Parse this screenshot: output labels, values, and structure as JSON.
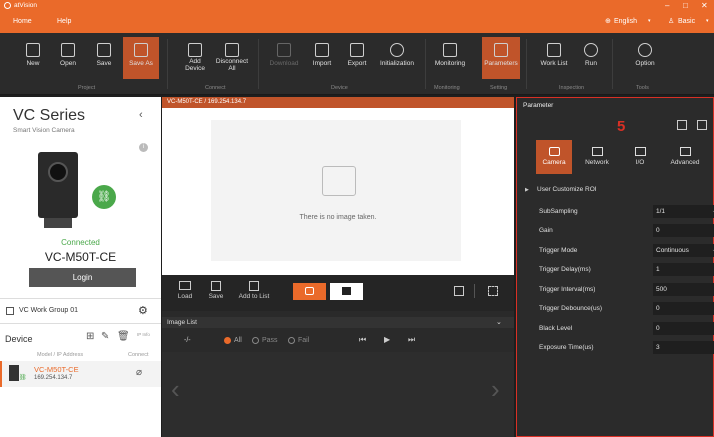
{
  "app": {
    "title": "atVision",
    "win_controls": [
      "–",
      "□",
      "✕"
    ]
  },
  "menu": {
    "home": "Home",
    "help": "Help",
    "language": "English",
    "mode": "Basic"
  },
  "ribbon": {
    "buttons": [
      {
        "label": "New",
        "icon": "new-file-icon"
      },
      {
        "label": "Open",
        "icon": "folder-open-icon"
      },
      {
        "label": "Save",
        "icon": "save-icon"
      },
      {
        "label": "Save As",
        "icon": "save-as-icon"
      },
      {
        "label": "Add Device",
        "icon": "add-device-icon"
      },
      {
        "label": "Disconnect All",
        "icon": "disconnect-icon"
      },
      {
        "label": "Download",
        "icon": "download-icon"
      },
      {
        "label": "Import",
        "icon": "import-icon"
      },
      {
        "label": "Export",
        "icon": "export-icon"
      },
      {
        "label": "Initialization",
        "icon": "reset-icon"
      },
      {
        "label": "Monitoring",
        "icon": "monitor-icon"
      },
      {
        "label": "Parameters",
        "icon": "sliders-icon"
      },
      {
        "label": "Work List",
        "icon": "clipboard-icon"
      },
      {
        "label": "Run",
        "icon": "play-icon"
      },
      {
        "label": "Option",
        "icon": "gear-icon"
      }
    ],
    "groups": [
      "Project",
      "Connect",
      "Device",
      "Monitoring",
      "Setting",
      "Inspection",
      "Tools"
    ]
  },
  "left": {
    "series": "VC Series",
    "subtitle": "Smart Vision Camera",
    "status": "Connected",
    "model": "VC-M50T-CE",
    "login": "Login",
    "workgroup": "VC Work Group 01",
    "device_header": "Device",
    "ip_header": "IP Info",
    "col_model": "Model / IP Address",
    "col_connect": "Connect",
    "devices": [
      {
        "model": "VC-M50T-CE",
        "ip": "169.254.134.7"
      }
    ]
  },
  "center": {
    "tab": "VC-M50T-CE / 169.254.134.7",
    "no_image": "There is no image taken.",
    "toolbar": [
      "Load",
      "Save",
      "Add to List"
    ],
    "image_list": "Image List",
    "counter": "-/-",
    "filters": [
      "All",
      "Pass",
      "Fail"
    ]
  },
  "right": {
    "header": "Parameter",
    "annotation": "5",
    "tabs": [
      "Camera",
      "Network",
      "I/O",
      "Advanced"
    ],
    "roi": "User Customize ROI",
    "params": [
      {
        "label": "SubSampling",
        "value": "1/1",
        "dropdown": true
      },
      {
        "label": "Gain",
        "value": "0",
        "dropdown": false
      },
      {
        "label": "Trigger Mode",
        "value": "Continuous",
        "dropdown": true
      },
      {
        "label": "Trigger Delay(ms)",
        "value": "1",
        "dropdown": false
      },
      {
        "label": "Trigger Interval(ms)",
        "value": "500",
        "dropdown": false
      },
      {
        "label": "Trigger Debounce(us)",
        "value": "0",
        "dropdown": false
      },
      {
        "label": "Black Level",
        "value": "0",
        "dropdown": false
      },
      {
        "label": "Exposure Time(us)",
        "value": "3",
        "dropdown": false
      }
    ]
  },
  "colors": {
    "accent": "#ea6a2a",
    "active": "#c0542a",
    "annotation": "#d93025",
    "connected": "#4aa84a"
  }
}
